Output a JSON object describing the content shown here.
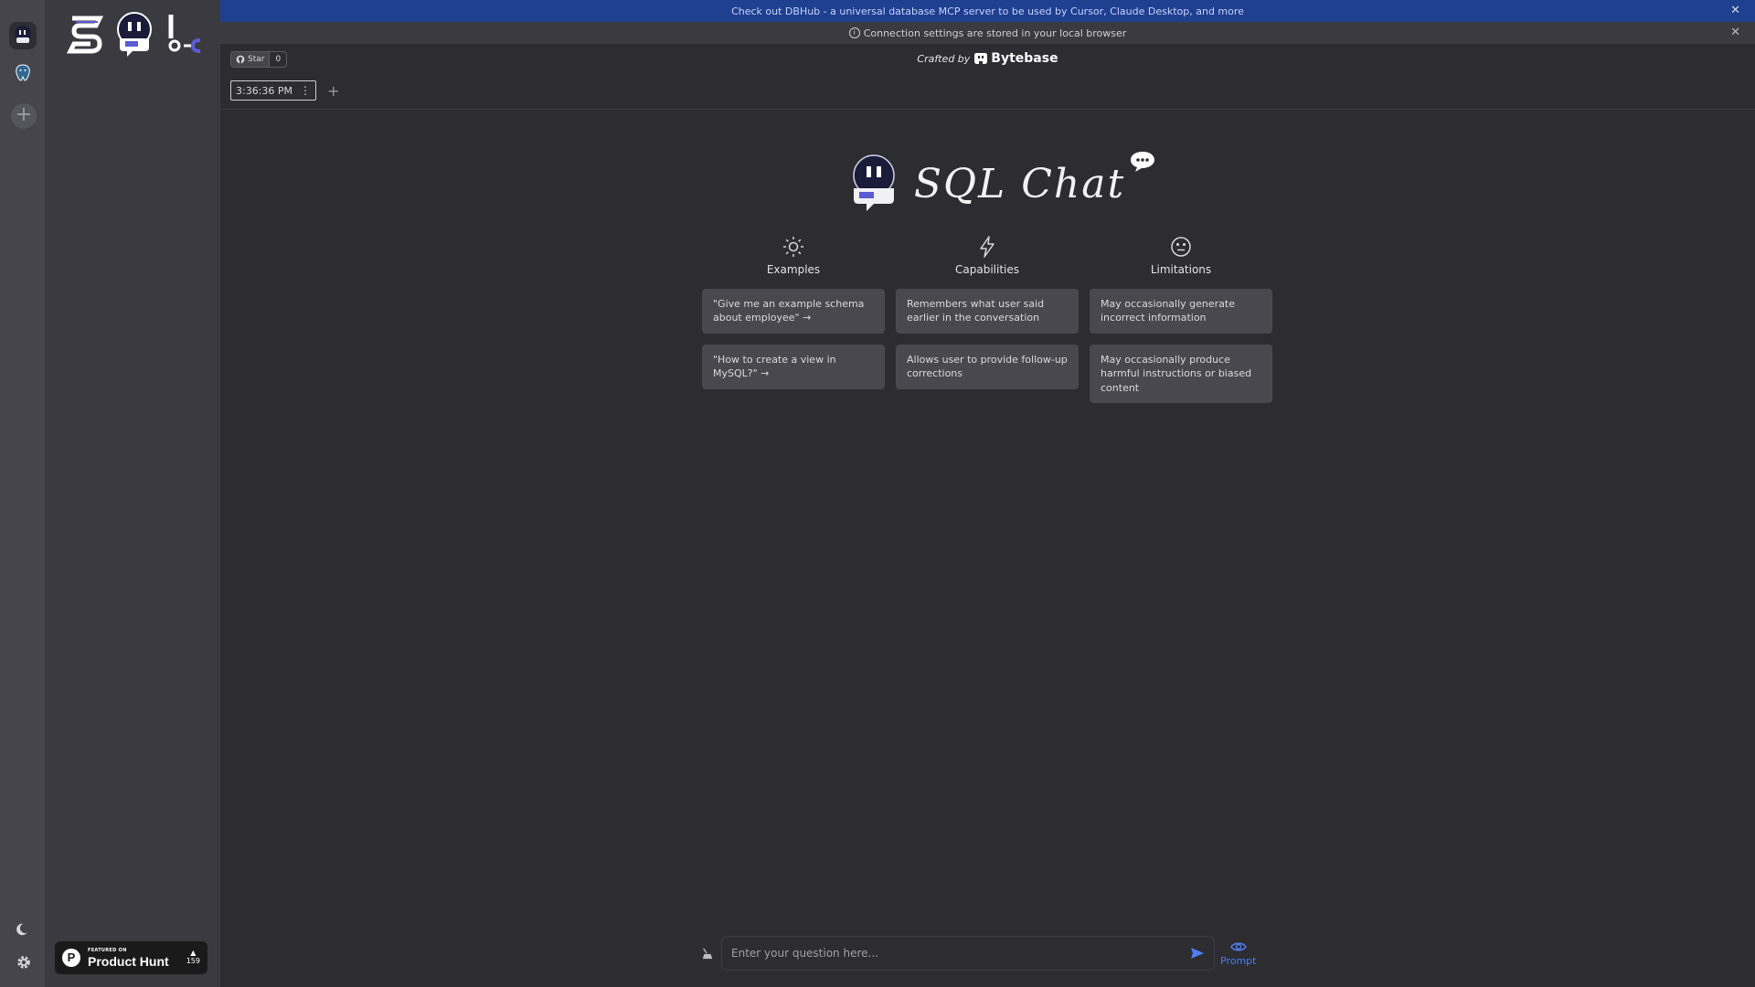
{
  "banner": {
    "text": "Check out DBHub - a universal database MCP server to be used by Cursor, Claude Desktop, and more",
    "close": "✕"
  },
  "notice": {
    "text": "Connection settings are stored in your local browser",
    "close": "✕"
  },
  "github": {
    "star_label": "Star",
    "star_count": "0"
  },
  "crafted": {
    "prefix": "Crafted by",
    "brand": "Bytebase"
  },
  "tabs": [
    {
      "label": "3:36:36 PM"
    }
  ],
  "tab_add": "+",
  "hero": {
    "title": "SQL Chat"
  },
  "columns": [
    {
      "title": "Examples",
      "icon": "sun-icon",
      "cards": [
        "\"Give me an example schema about employee\" →",
        "\"How to create a view in MySQL?\" →"
      ]
    },
    {
      "title": "Capabilities",
      "icon": "lightning-icon",
      "cards": [
        "Remembers what user said earlier in the conversation",
        "Allows user to provide follow-up corrections"
      ]
    },
    {
      "title": "Limitations",
      "icon": "neutral-face-icon",
      "cards": [
        "May occasionally generate incorrect information",
        "May occasionally produce harmful instructions or biased content"
      ]
    }
  ],
  "input": {
    "placeholder": "Enter your question here..."
  },
  "prompt_toggle": {
    "label": "Prompt"
  },
  "product_hunt": {
    "featured": "FEATURED ON",
    "name": "Product Hunt",
    "votes": "159"
  },
  "colors": {
    "banner_bg": "#1f3f8f",
    "accent": "#4f7df2",
    "card_bg": "#48484e"
  }
}
